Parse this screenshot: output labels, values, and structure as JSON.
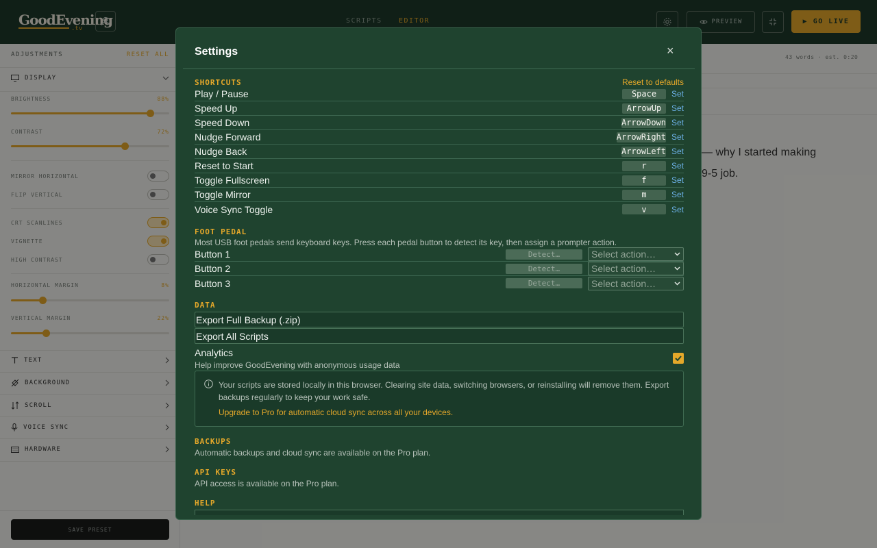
{
  "app": {
    "logo": "GoodEvening",
    "logo_suffix": ".tv",
    "nav_tabs": [
      "SCRIPTS",
      "EDITOR"
    ],
    "preview_label": "PREVIEW",
    "golive_label": "▶ GO LIVE"
  },
  "sidebar": {
    "title": "ADJUSTMENTS",
    "reset_all": "RESET ALL",
    "display_label": "DISPLAY",
    "sliders": [
      {
        "label": "BRIGHTNESS",
        "value": "88%",
        "fraction": 0.88
      },
      {
        "label": "CONTRAST",
        "value": "72%",
        "fraction": 0.72
      }
    ],
    "toggles": [
      {
        "label": "MIRROR HORIZONTAL",
        "on": false
      },
      {
        "label": "FLIP VERTICAL",
        "on": false
      },
      {
        "label": "CRT SCANLINES",
        "on": true
      },
      {
        "label": "VIGNETTE",
        "on": true
      },
      {
        "label": "HIGH CONTRAST",
        "on": false
      }
    ],
    "margin_sliders": [
      {
        "label": "HORIZONTAL MARGIN",
        "value": "8%",
        "fraction": 0.2
      },
      {
        "label": "VERTICAL MARGIN",
        "value": "22%",
        "fraction": 0.22
      }
    ],
    "sections": [
      "TEXT",
      "BACKGROUND",
      "SCROLL",
      "VOICE SYNC",
      "HARDWARE"
    ],
    "save_preset": "SAVE PRESET"
  },
  "main": {
    "meta": "43 words · est. 0:20",
    "text_line_1": "— why I started making",
    "text_line_2": "9-5 job."
  },
  "modal": {
    "title": "Settings",
    "close": "×",
    "shortcuts": {
      "title": "SHORTCUTS",
      "reset": "Reset to defaults",
      "set_label": "Set",
      "items": [
        {
          "label": "Play / Pause",
          "key": "Space"
        },
        {
          "label": "Speed Up",
          "key": "ArrowUp"
        },
        {
          "label": "Speed Down",
          "key": "ArrowDown"
        },
        {
          "label": "Nudge Forward",
          "key": "ArrowRight"
        },
        {
          "label": "Nudge Back",
          "key": "ArrowLeft"
        },
        {
          "label": "Reset to Start",
          "key": "r"
        },
        {
          "label": "Toggle Fullscreen",
          "key": "f"
        },
        {
          "label": "Toggle Mirror",
          "key": "m"
        },
        {
          "label": "Voice Sync Toggle",
          "key": "v"
        }
      ]
    },
    "foot_pedal": {
      "title": "FOOT PEDAL",
      "desc": "Most USB foot pedals send keyboard keys. Press each pedal button to detect its key, then assign a prompter action.",
      "detect_label": "Detect…",
      "select_placeholder": "Select action…",
      "buttons": [
        "Button 1",
        "Button 2",
        "Button 3"
      ]
    },
    "data": {
      "title": "DATA",
      "export_backup": "Export Full Backup (.zip)",
      "export_scripts": "Export All Scripts",
      "analytics_label": "Analytics",
      "analytics_desc": "Help improve GoodEvening with anonymous usage data",
      "analytics_on": true,
      "info_text": "Your scripts are stored locally in this browser. Clearing site data, switching browsers, or reinstalling will remove them. Export backups regularly to keep your work safe.",
      "upgrade_text": "Upgrade to Pro for automatic cloud sync across all your devices."
    },
    "backups": {
      "title": "BACKUPS",
      "desc": "Automatic backups and cloud sync are available on the Pro plan."
    },
    "api_keys": {
      "title": "API KEYS",
      "desc": "API access is available on the Pro plan."
    },
    "help": {
      "title": "HELP"
    }
  },
  "colors": {
    "accent": "#e5a82a",
    "modal_bg": "#1f432f",
    "link": "#6cb0e6"
  }
}
